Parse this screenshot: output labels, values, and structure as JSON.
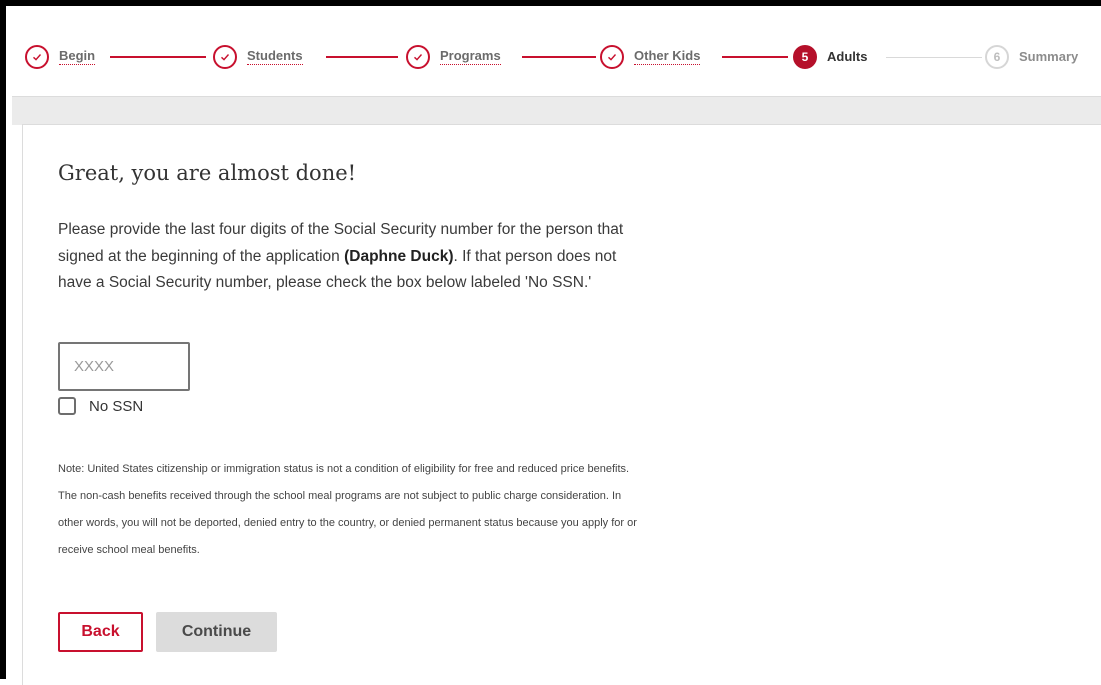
{
  "stepper": {
    "steps": [
      {
        "label": "Begin",
        "number": "1",
        "status": "completed"
      },
      {
        "label": "Students",
        "number": "2",
        "status": "completed"
      },
      {
        "label": "Programs",
        "number": "3",
        "status": "completed"
      },
      {
        "label": "Other Kids",
        "number": "4",
        "status": "completed"
      },
      {
        "label": "Adults",
        "number": "5",
        "status": "current"
      },
      {
        "label": "Summary",
        "number": "6",
        "status": "upcoming"
      }
    ]
  },
  "main": {
    "title": "Great, you are almost done!",
    "intro_before": "Please provide the last four digits of the Social Security number for the person that signed at the beginning of the application ",
    "signer_name": "(Daphne Duck)",
    "intro_after": ". If that person does not have a Social Security number, please check the box below labeled 'No SSN.'",
    "ssn_input": {
      "value": "",
      "placeholder": "XXXX"
    },
    "no_ssn_label": "No SSN",
    "no_ssn_checked": false,
    "note": "Note: United States citizenship or immigration status is not a condition of eligibility for free and reduced price benefits. The non-cash benefits received through the school meal programs are not subject to public charge consideration. In other words, you will not be deported, denied entry to the country, or denied permanent status because you apply for or receive school meal benefits."
  },
  "buttons": {
    "back_label": "Back",
    "continue_label": "Continue"
  },
  "colors": {
    "accent": "#c8102e",
    "active_step": "#b5102a",
    "band": "#ebebeb",
    "continue_bg": "#dcdcdc"
  },
  "icons": {
    "completed_step": "check-icon"
  }
}
